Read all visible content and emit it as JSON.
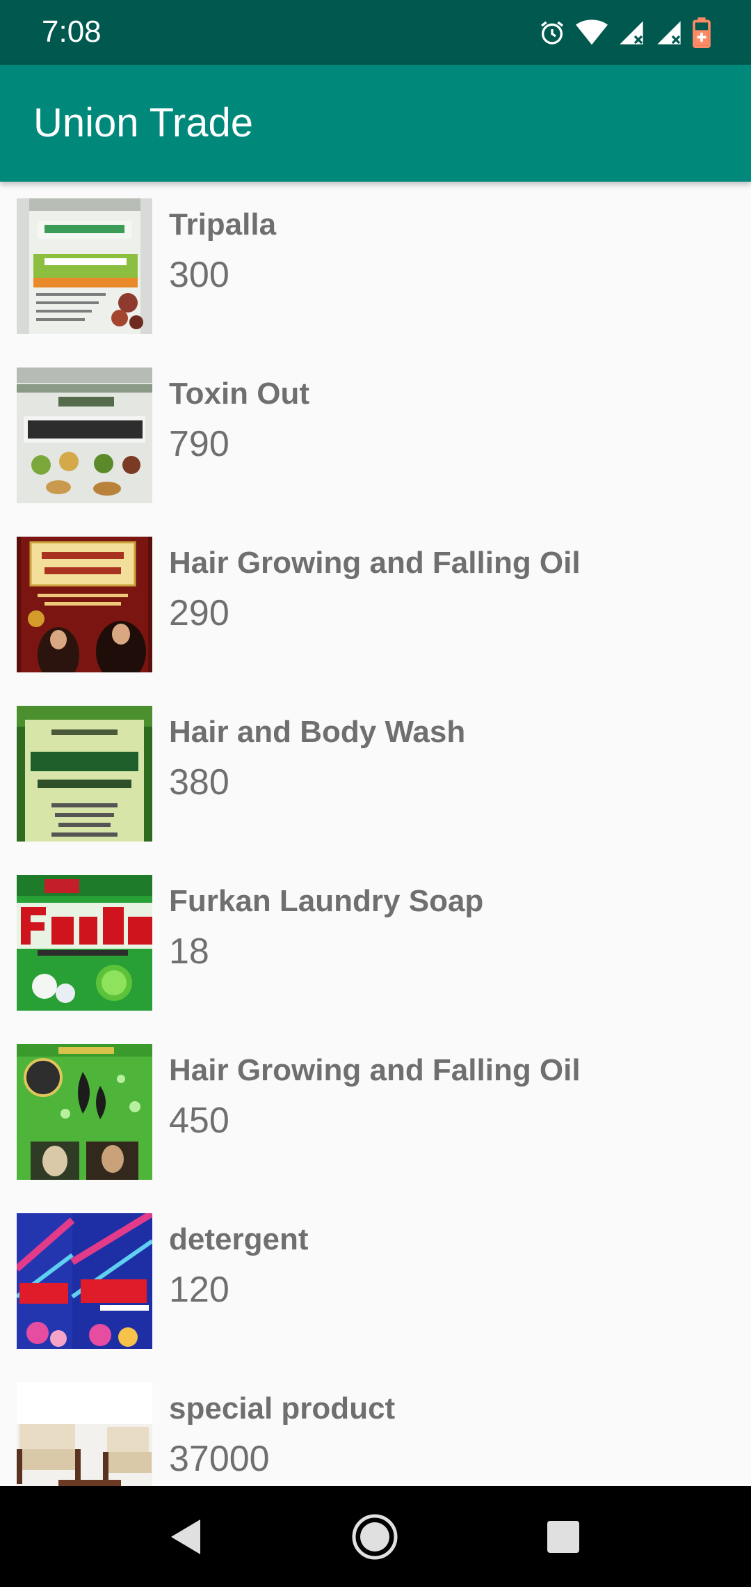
{
  "status_bar": {
    "time": "7:08",
    "icons": [
      "alarm-icon",
      "wifi-icon",
      "signal-icon",
      "signal-icon",
      "battery-icon"
    ]
  },
  "app_bar": {
    "title": "Union Trade"
  },
  "products": [
    {
      "name": "Tripalla",
      "price": "300",
      "image": "triphala-jar"
    },
    {
      "name": "Toxin Out",
      "price": "790",
      "image": "toxin-out-jar"
    },
    {
      "name": "Hair Growing and Falling Oil",
      "price": "290",
      "image": "hair-oil-box"
    },
    {
      "name": "Hair and Body Wash",
      "price": "380",
      "image": "aloe-vera-bottle"
    },
    {
      "name": "Furkan Laundry Soap",
      "price": "18",
      "image": "furkan-soap-pack"
    },
    {
      "name": "Hair Growing and Falling Oil",
      "price": "450",
      "image": "hair-oil-green-box"
    },
    {
      "name": "detergent",
      "price": "120",
      "image": "furkan-detergent-packs"
    },
    {
      "name": "special product",
      "price": "37000",
      "image": "sofa-set"
    }
  ],
  "nav_bar": {
    "buttons": [
      "back-icon",
      "home-icon",
      "recents-icon"
    ]
  },
  "colors": {
    "status_bar": "#00584f",
    "app_bar": "#00897b",
    "text": "#6f6f6f",
    "background": "#fafafa"
  }
}
